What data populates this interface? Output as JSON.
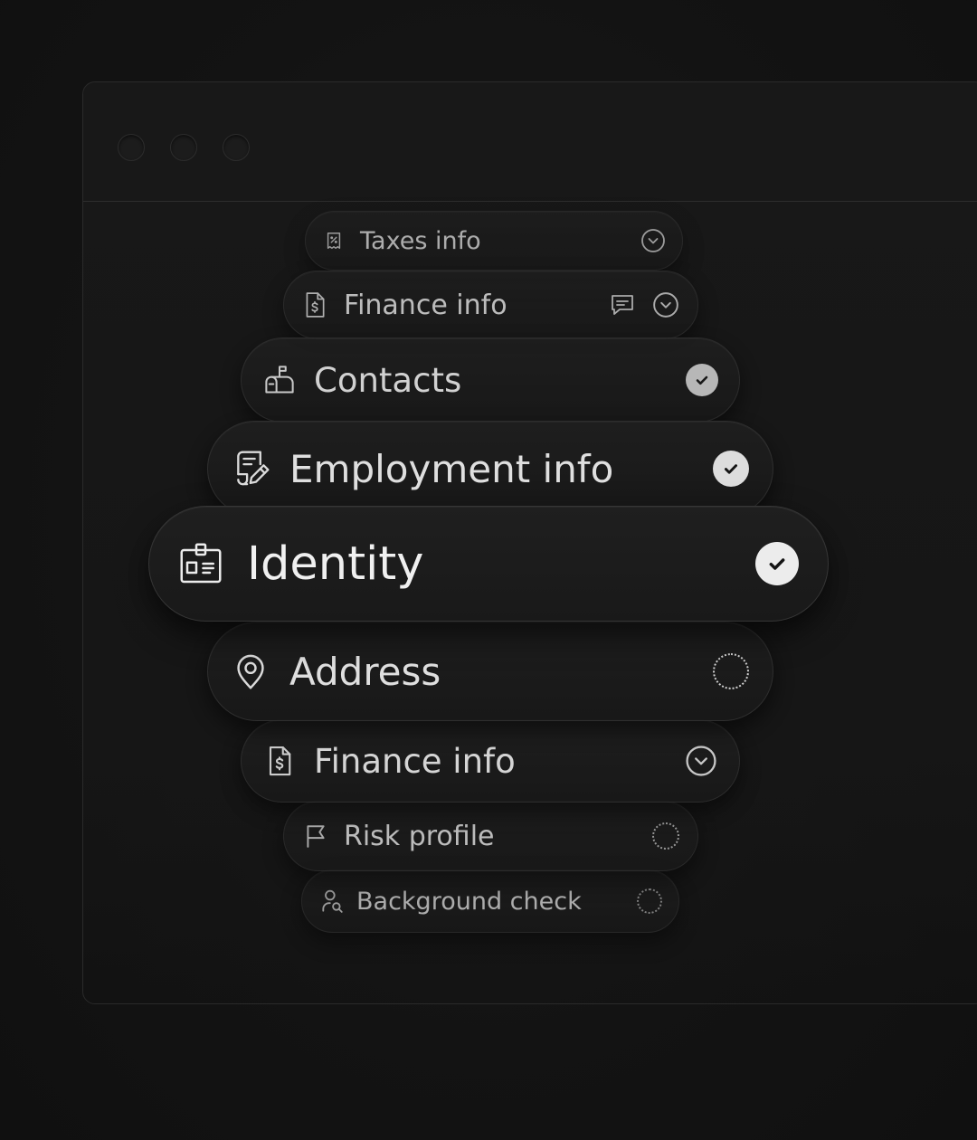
{
  "window": {
    "controls": [
      "close",
      "minimize",
      "maximize"
    ]
  },
  "steps": [
    {
      "id": "taxes-info",
      "label": "Taxes info",
      "icon": "receipt-percent-icon",
      "status": "expand"
    },
    {
      "id": "finance-info-top",
      "label": "Finance info",
      "icon": "document-dollar-icon",
      "status": "expand",
      "extra": "comment-icon"
    },
    {
      "id": "contacts",
      "label": "Contacts",
      "icon": "mailbox-icon",
      "status": "complete"
    },
    {
      "id": "employment-info",
      "label": "Employment info",
      "icon": "document-edit-icon",
      "status": "complete"
    },
    {
      "id": "identity",
      "label": "Identity",
      "icon": "id-badge-icon",
      "status": "complete"
    },
    {
      "id": "address",
      "label": "Address",
      "icon": "map-pin-icon",
      "status": "pending"
    },
    {
      "id": "finance-info-bottom",
      "label": "Finance info",
      "icon": "document-dollar-icon",
      "status": "expand"
    },
    {
      "id": "risk-profile",
      "label": "Risk profile",
      "icon": "flag-icon",
      "status": "pending"
    },
    {
      "id": "background-check",
      "label": "Background check",
      "icon": "user-search-icon",
      "status": "pending"
    }
  ]
}
